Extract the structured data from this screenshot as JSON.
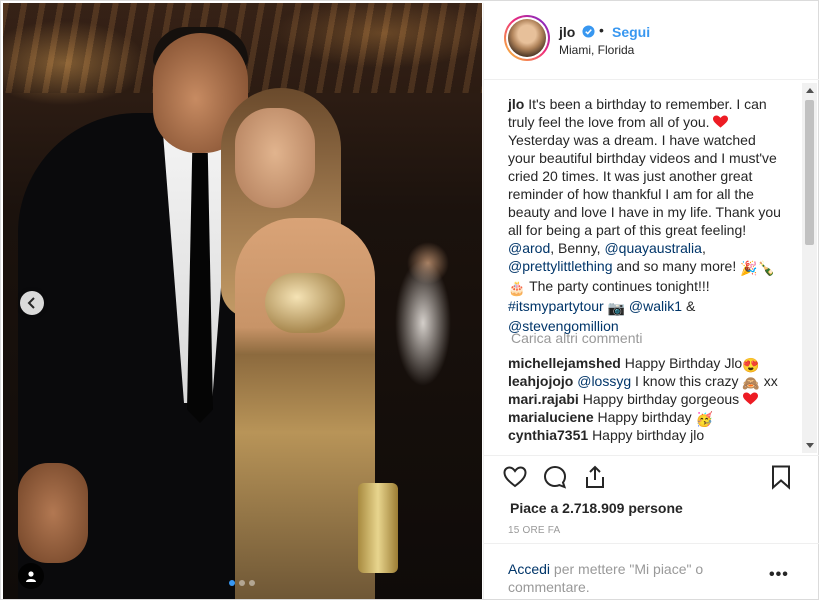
{
  "header": {
    "username": "jlo",
    "separator": "•",
    "follow_label": "Segui",
    "location": "Miami, Florida"
  },
  "caption": {
    "username": "jlo",
    "text_1": "It's been a birthday to remember. I can truly feel the love from all of you.",
    "text_2": "Yesterday was a dream. I have watched your beautiful birthday videos and I must've cried 20 times. It was just another great reminder of how thankful I am for all the beauty and love I have in my life. Thank you all for being a part of this great feeling!",
    "mention_arod": "@arod",
    "text_benny": ", Benny,",
    "mention_quay": "@quayaustralia",
    "comma": ",",
    "mention_plt": "@prettylittlething",
    "text_more": "and so many more!",
    "text_party": "The party continues tonight!!!",
    "hashtag": "#itsmypartytour",
    "mention_walik": "@walik1",
    "amp": "&",
    "mention_steven": "@stevengomillion"
  },
  "load_more_label": "Carica altri commenti",
  "comments": [
    {
      "user": "michellejamshed",
      "text": "Happy Birthday Jlo"
    },
    {
      "user": "leahjojojo",
      "mention": "@lossyg",
      "text": "I know this crazy",
      "suffix": "xx"
    },
    {
      "user": "mari.rajabi",
      "text": "Happy birthday gorgeous"
    },
    {
      "user": "marialuciene",
      "text": "Happy birthday"
    },
    {
      "user": "cynthia7351",
      "text": "Happy birthday jlo"
    }
  ],
  "likes_text": "Piace a 2.718.909 persone",
  "timestamp": "15 ORE FA",
  "add_comment": {
    "login_label": "Accedi",
    "rest_text": "per mettere \"Mi piace\" o commentare.",
    "more_label": "•••"
  },
  "carousel": {
    "total_slides": 3,
    "active_slide": 1
  },
  "colors": {
    "accent": "#3897f0",
    "heart": "#ed4956",
    "link": "#003569",
    "muted": "#999999"
  },
  "icons": [
    "chevron-left-icon",
    "user-tag-icon",
    "verified-icon",
    "heart-icon",
    "comment-icon",
    "share-icon",
    "bookmark-icon"
  ]
}
